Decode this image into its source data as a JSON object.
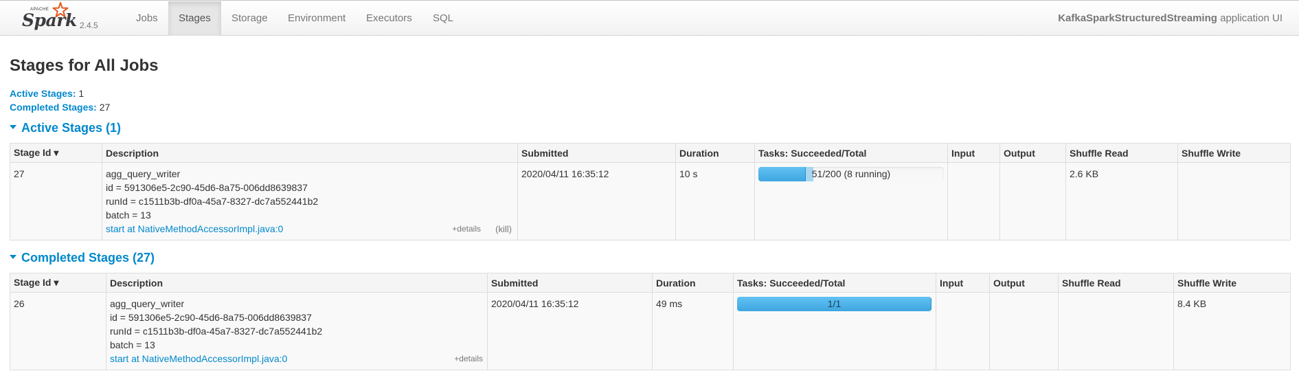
{
  "brand": {
    "apache": "APACHE",
    "name": "Spark",
    "version": "2.4.5"
  },
  "nav": {
    "tabs": [
      {
        "label": "Jobs"
      },
      {
        "label": "Stages"
      },
      {
        "label": "Storage"
      },
      {
        "label": "Environment"
      },
      {
        "label": "Executors"
      },
      {
        "label": "SQL"
      }
    ],
    "active_tab": "Stages",
    "app_name": "KafkaSparkStructuredStreaming",
    "app_suffix": " application UI"
  },
  "page": {
    "title": "Stages for All Jobs",
    "active_stages_label": "Active Stages:",
    "active_stages_count": "1",
    "completed_stages_label": "Completed Stages:",
    "completed_stages_count": "27"
  },
  "active": {
    "section_title": "Active Stages (1)",
    "headers": [
      "Stage Id ▾",
      "Description",
      "Submitted",
      "Duration",
      "Tasks: Succeeded/Total",
      "Input",
      "Output",
      "Shuffle Read",
      "Shuffle Write"
    ],
    "rows": [
      {
        "stage_id": "27",
        "desc_lines": [
          "agg_query_writer",
          "id = 591306e5-2c90-45d6-8a75-006dd8639837",
          "runId = c1511b3b-df0a-45a7-8327-dc7a552441b2",
          "batch = 13"
        ],
        "call_site": "start at NativeMethodAccessorImpl.java:0",
        "details": "+details",
        "kill": "(kill)",
        "submitted": "2020/04/11 16:35:12",
        "duration": "10 s",
        "tasks_label": "51/200 (8 running)",
        "tasks_succeeded": 51,
        "tasks_running": 8,
        "tasks_total": 200,
        "input": "",
        "output": "",
        "shuffle_read": "2.6 KB",
        "shuffle_write": ""
      }
    ]
  },
  "completed": {
    "section_title": "Completed Stages (27)",
    "headers": [
      "Stage Id ▾",
      "Description",
      "Submitted",
      "Duration",
      "Tasks: Succeeded/Total",
      "Input",
      "Output",
      "Shuffle Read",
      "Shuffle Write"
    ],
    "rows": [
      {
        "stage_id": "26",
        "desc_lines": [
          "agg_query_writer",
          "id = 591306e5-2c90-45d6-8a75-006dd8639837",
          "runId = c1511b3b-df0a-45a7-8327-dc7a552441b2",
          "batch = 13"
        ],
        "call_site": "start at NativeMethodAccessorImpl.java:0",
        "details": "+details",
        "submitted": "2020/04/11 16:35:12",
        "duration": "49 ms",
        "tasks_label": "1/1",
        "tasks_succeeded": 1,
        "tasks_running": 0,
        "tasks_total": 1,
        "input": "",
        "output": "",
        "shuffle_read": "",
        "shuffle_write": "8.4 KB"
      }
    ]
  },
  "colors": {
    "link": "#0088cc",
    "progress_done": "#3ea6e0",
    "progress_running": "#a7d6f0",
    "brand_star": "#e25a1c"
  }
}
